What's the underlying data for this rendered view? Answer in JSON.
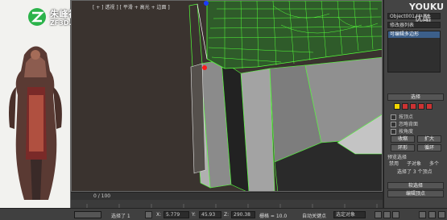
{
  "watermark": {
    "title": "朱峰视频教程社区",
    "url": "ZF3D.COM",
    "youku": "YOUKU",
    "youku_cn": "优酷"
  },
  "viewport": {
    "label": "[ + ] 透视 ] [ 平滑 + 高光 + 边面 ]"
  },
  "command_panel": {
    "object_name": "Object001",
    "modifier_list": "修改器列表",
    "stack_item": "可编辑多边形",
    "section_select": "选择",
    "check_vertex": "按顶点",
    "check_backface": "忽略背面",
    "check_angle": "按角度",
    "btn_shrink": "收缩",
    "btn_grow": "扩大",
    "btn_ring": "环形",
    "btn_loop": "循环",
    "preview_label": "预览选择",
    "radio_off": "禁用",
    "radio_sub": "子对象",
    "radio_multi": "多个",
    "selected_count": "选择了 3 个顶点",
    "section_soft": "软选择",
    "section_edit_vertex": "编辑顶点"
  },
  "timeline": {
    "frame": "0 / 100"
  },
  "status": {
    "selection": "选择了 1",
    "x_label": "X:",
    "x_val": "5.779",
    "y_label": "Y:",
    "y_val": "45.93",
    "z_label": "Z:",
    "z_val": "290.38",
    "grid": "栅格 = 10.0",
    "autokey": "自动关键点",
    "selected_obj": "选定对象"
  },
  "colors": {
    "viewport_bg": "#3a332f",
    "wire": "#54ff3a",
    "mesh_gray": "#8b8b8b"
  }
}
